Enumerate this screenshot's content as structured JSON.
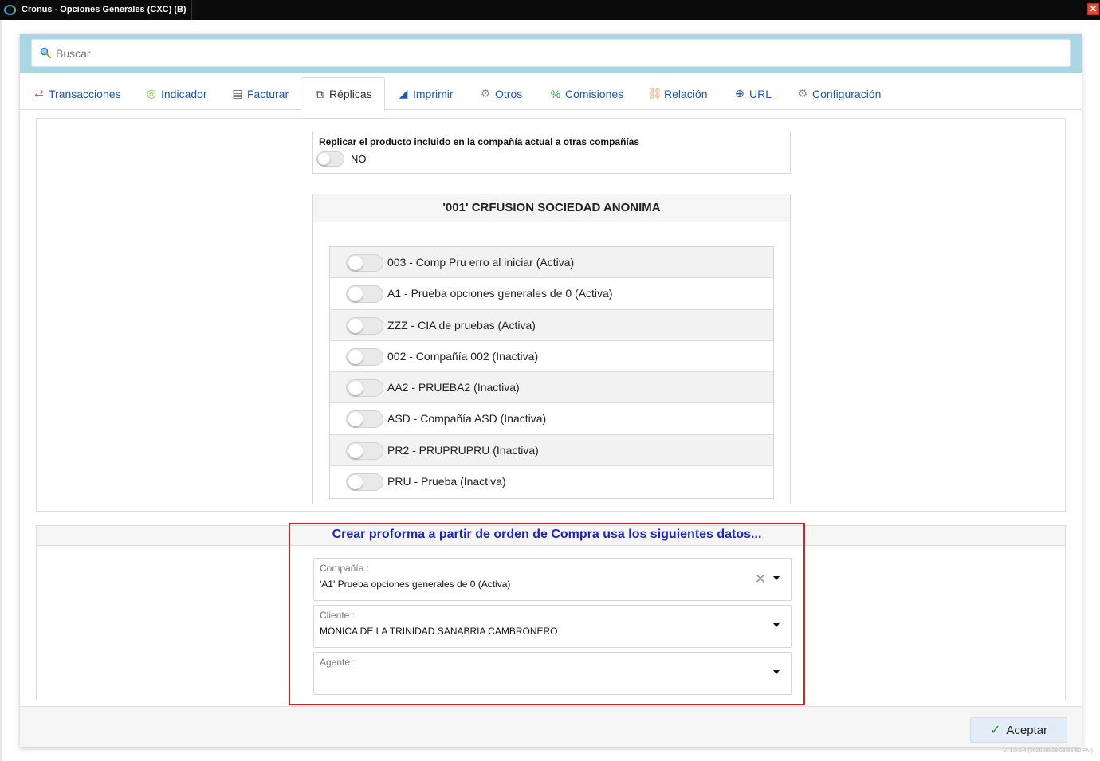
{
  "window": {
    "title": "Cronus - Opciones Generales (CXC) (B)",
    "close_glyph": "✕"
  },
  "search": {
    "placeholder": "Buscar"
  },
  "tabs": [
    {
      "label": "Transacciones",
      "icon": "exchange-arrows-icon",
      "glyph": "⇄",
      "color": "#e05a4a"
    },
    {
      "label": "Indicador",
      "icon": "target-icon",
      "glyph": "◎",
      "color": "#7cc23a"
    },
    {
      "label": "Facturar",
      "icon": "document-icon",
      "glyph": "▤",
      "color": "#555555"
    },
    {
      "label": "Réplicas",
      "icon": "copy-icon",
      "glyph": "⧉",
      "color": "#333333",
      "active": true
    },
    {
      "label": "Imprimir",
      "icon": "chart-icon",
      "glyph": "◢",
      "color": "#1a58b8"
    },
    {
      "label": "Otros",
      "icon": "gears-icon",
      "glyph": "⚙",
      "color": "#888888"
    },
    {
      "label": "Comisiones",
      "icon": "percent-icon",
      "glyph": "%",
      "color": "#2a9a3a"
    },
    {
      "label": "Relación",
      "icon": "link-icon",
      "glyph": "⛓",
      "color": "#d99a4a"
    },
    {
      "label": "URL",
      "icon": "globe-icon",
      "glyph": "⊕",
      "color": "#1a58b8"
    },
    {
      "label": "Configuración",
      "icon": "gear-icon",
      "glyph": "⚙",
      "color": "#888888"
    }
  ],
  "replicate": {
    "label": "Replicar el producto incluido en la compañía actual a otras compañías",
    "value": "NO"
  },
  "company_group": {
    "title": "'001' CRFUSION SOCIEDAD ANONIMA",
    "companies": [
      "003 - Comp Pru erro al iniciar (Activa)",
      "A1 - Prueba opciones generales de 0 (Activa)",
      "ZZZ - CIA de pruebas (Activa)",
      "002 - Compañía 002 (Inactiva)",
      "AA2 - PRUEBA2 (Inactiva)",
      "ASD - Compañía ASD (Inactiva)",
      "PR2 - PRUPRUPRU (Inactiva)",
      "PRU - Prueba (Inactiva)"
    ]
  },
  "proforma": {
    "title": "Crear proforma a partir de orden de Compra usa los siguientes datos...",
    "company": {
      "label": "Compañía :",
      "value": "'A1' Prueba opciones generales de 0 (Activa)"
    },
    "client": {
      "label": "Cliente :",
      "value": "MONICA DE LA TRINIDAD SANABRIA CAMBRONERO"
    },
    "agent": {
      "label": "Agente :",
      "value": ""
    }
  },
  "footer": {
    "accept_label": "Aceptar",
    "version": "V. 1.0.5.4 (2026/08/08 03:55:52 PM)"
  },
  "colors": {
    "accent": "#1a58b8",
    "highlight_border": "#e01b1b",
    "search_band": "#a9d7e4"
  }
}
